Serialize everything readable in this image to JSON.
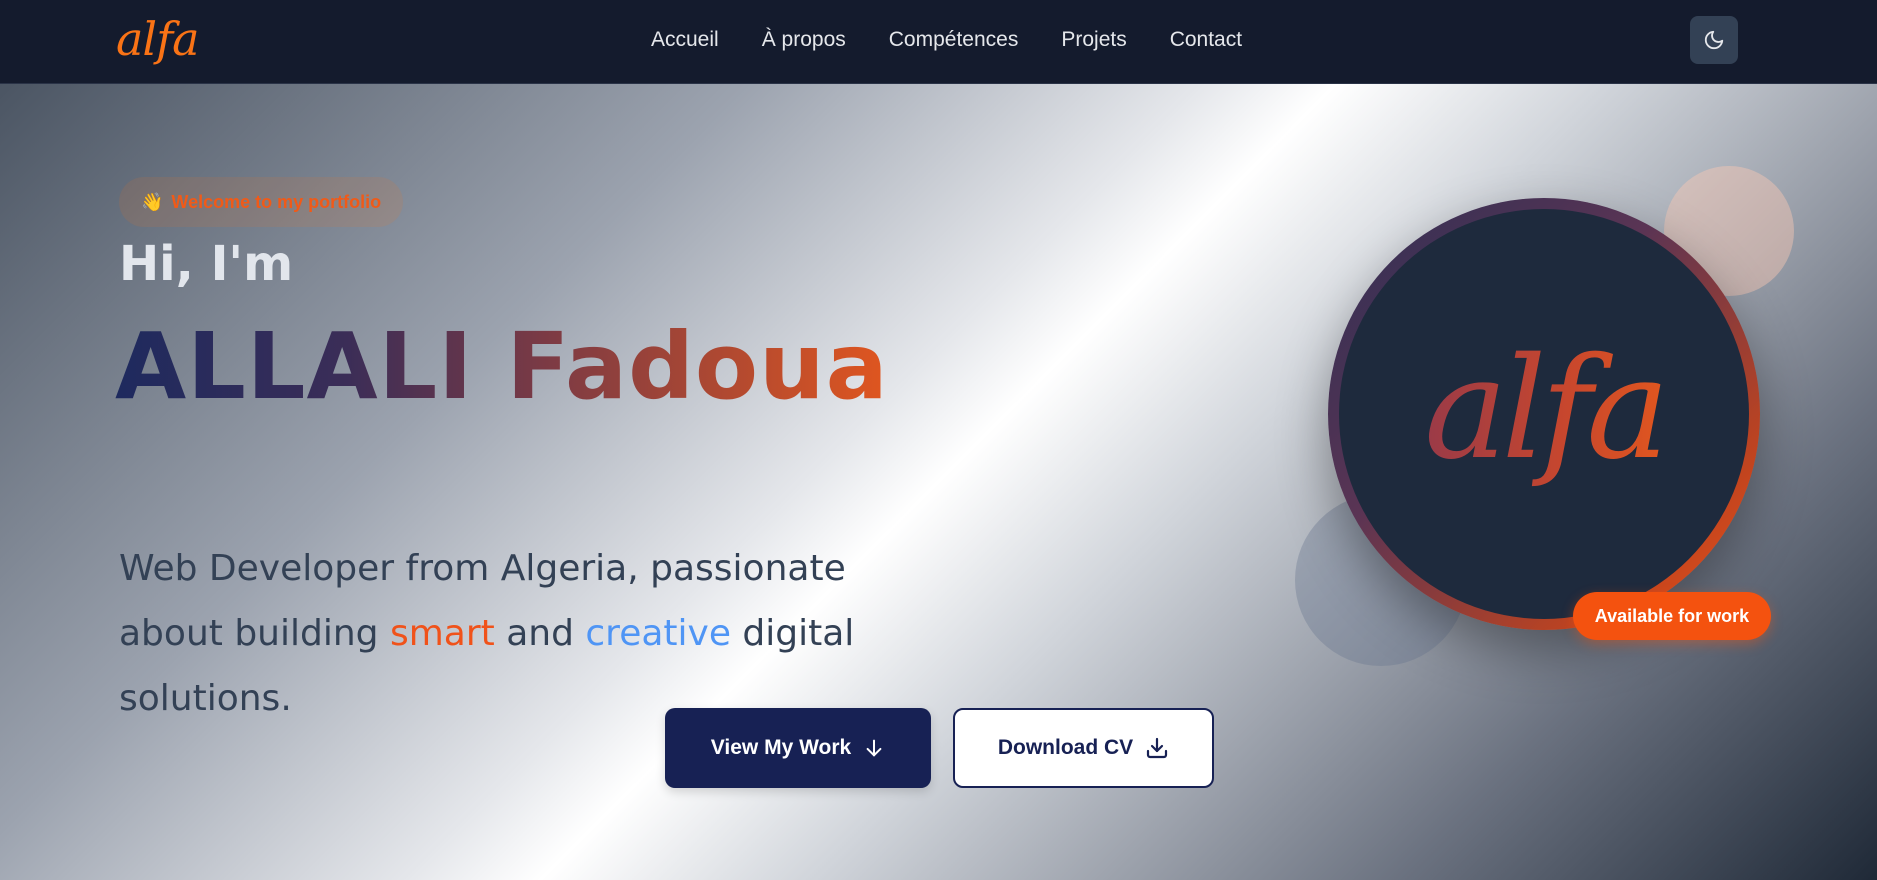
{
  "nav": {
    "logo": "alfa",
    "links": [
      "Accueil",
      "À propos",
      "Compétences",
      "Projets",
      "Contact"
    ],
    "theme_icon": "moon-icon"
  },
  "hero": {
    "badge_emoji": "👋",
    "badge_text": "Welcome to my portfolio",
    "greeting": "Hi, I'm",
    "name": "ALLALI Fadoua",
    "intro": {
      "part1": "Web Developer from Algeria, passionate about building ",
      "highlight1": "smart",
      "part2": " and ",
      "highlight2": "creative",
      "part3": " digital solutions."
    },
    "primary_button": "View My Work",
    "secondary_button": "Download CV",
    "avatar_text": "alfa",
    "status": "Available for work"
  },
  "colors": {
    "accent": "#f97316",
    "navy": "#172154",
    "blue_highlight": "#4f95f5"
  }
}
